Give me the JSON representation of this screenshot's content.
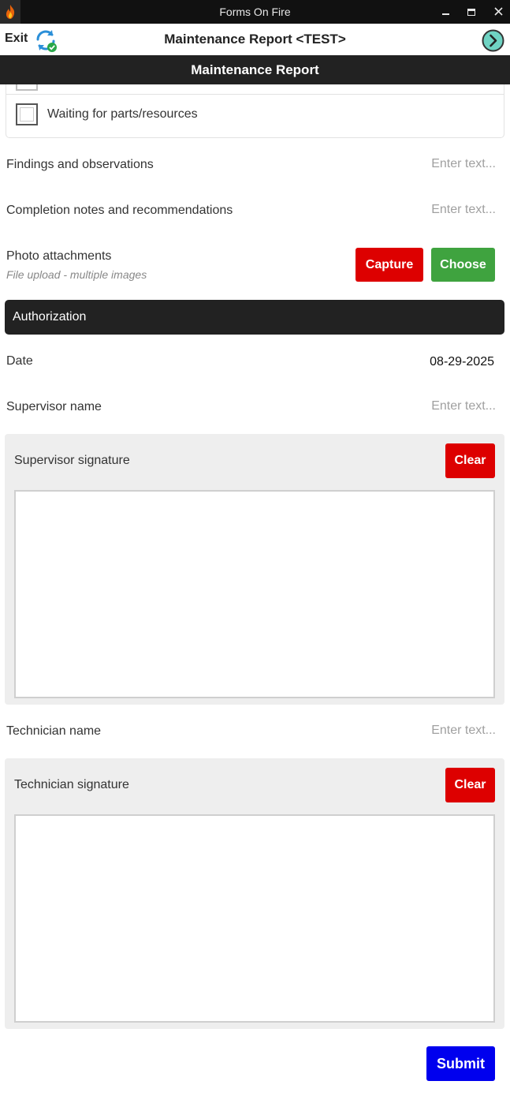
{
  "window": {
    "title": "Forms On Fire",
    "app_icon": "flame-icon",
    "minimize_icon": "minimize-icon",
    "maximize_icon": "maximize-icon",
    "close_icon": "close-icon"
  },
  "appbar": {
    "exit_label": "Exit",
    "sync_icon": "sync-icon",
    "title": "Maintenance Report <TEST>",
    "next_icon": "chevron-right-icon"
  },
  "form": {
    "header": "Maintenance Report",
    "checkbox_options": [
      {
        "label": "Waiting for parts/resources",
        "checked": false
      }
    ],
    "fields": {
      "findings": {
        "label": "Findings and observations",
        "placeholder": "Enter text...",
        "value": ""
      },
      "completion_notes": {
        "label": "Completion notes and recommendations",
        "placeholder": "Enter text...",
        "value": ""
      },
      "photo": {
        "label": "Photo attachments",
        "hint": "File upload - multiple images",
        "capture_label": "Capture",
        "choose_label": "Choose"
      }
    },
    "authorization": {
      "section_title": "Authorization",
      "date": {
        "label": "Date",
        "value": "08-29-2025"
      },
      "supervisor_name": {
        "label": "Supervisor name",
        "placeholder": "Enter text...",
        "value": ""
      },
      "supervisor_signature": {
        "label": "Supervisor signature",
        "clear_label": "Clear"
      },
      "technician_name": {
        "label": "Technician name",
        "placeholder": "Enter text...",
        "value": ""
      },
      "technician_signature": {
        "label": "Technician signature",
        "clear_label": "Clear"
      }
    },
    "submit_label": "Submit"
  },
  "colors": {
    "dark_band": "#222222",
    "capture_red": "#dd0000",
    "choose_green": "#3fa33f",
    "submit_blue": "#0000ee",
    "signature_panel": "#eeeeee"
  }
}
